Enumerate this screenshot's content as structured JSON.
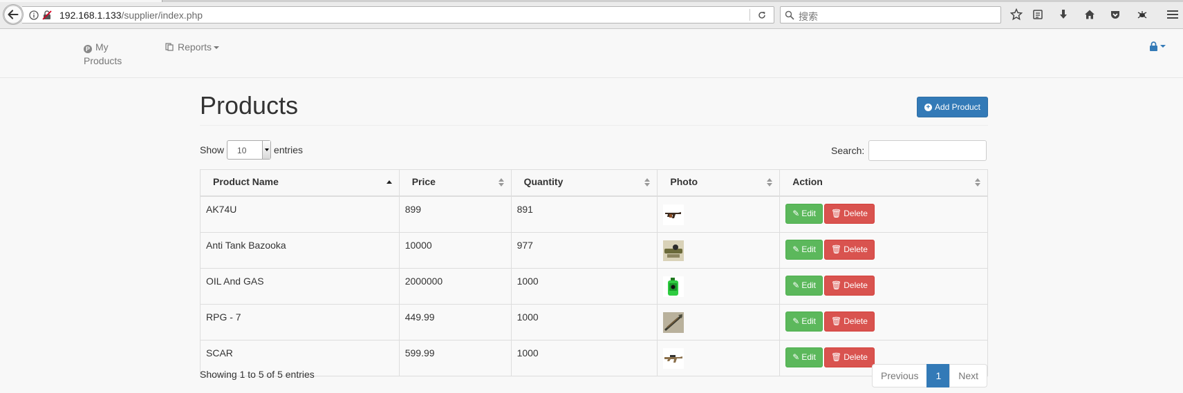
{
  "browser": {
    "url_host": "192.168.1.133",
    "url_path": "/supplier/index.php",
    "search_placeholder": "搜索"
  },
  "navbar": {
    "products_label_line1": "My",
    "products_label_line2": "Products",
    "reports_label": "Reports"
  },
  "page": {
    "title": "Products",
    "add_button": "Add Product",
    "show_label": "Show",
    "entries_value": "10",
    "entries_label": "entries",
    "search_label": "Search:"
  },
  "table": {
    "columns": [
      "Product Name",
      "Price",
      "Quantity",
      "Photo",
      "Action"
    ],
    "rows": [
      {
        "name": "AK74U",
        "price": "899",
        "quantity": "891",
        "photo": "rifle-photo"
      },
      {
        "name": "Anti Tank Bazooka",
        "price": "10000",
        "quantity": "977",
        "photo": "bazooka-photo"
      },
      {
        "name": "OIL And GAS",
        "price": "2000000",
        "quantity": "1000",
        "photo": "gas-can-photo"
      },
      {
        "name": "RPG - 7",
        "price": "449.99",
        "quantity": "1000",
        "photo": "rpg-photo"
      },
      {
        "name": "SCAR",
        "price": "599.99",
        "quantity": "1000",
        "photo": "scar-photo"
      }
    ],
    "edit_label": "Edit",
    "delete_label": "Delete"
  },
  "footer": {
    "info": "Showing 1 to 5 of 5 entries",
    "prev": "Previous",
    "page": "1",
    "next": "Next"
  },
  "colors": {
    "primary": "#337ab7",
    "success": "#5cb85c",
    "danger": "#d9534f"
  }
}
